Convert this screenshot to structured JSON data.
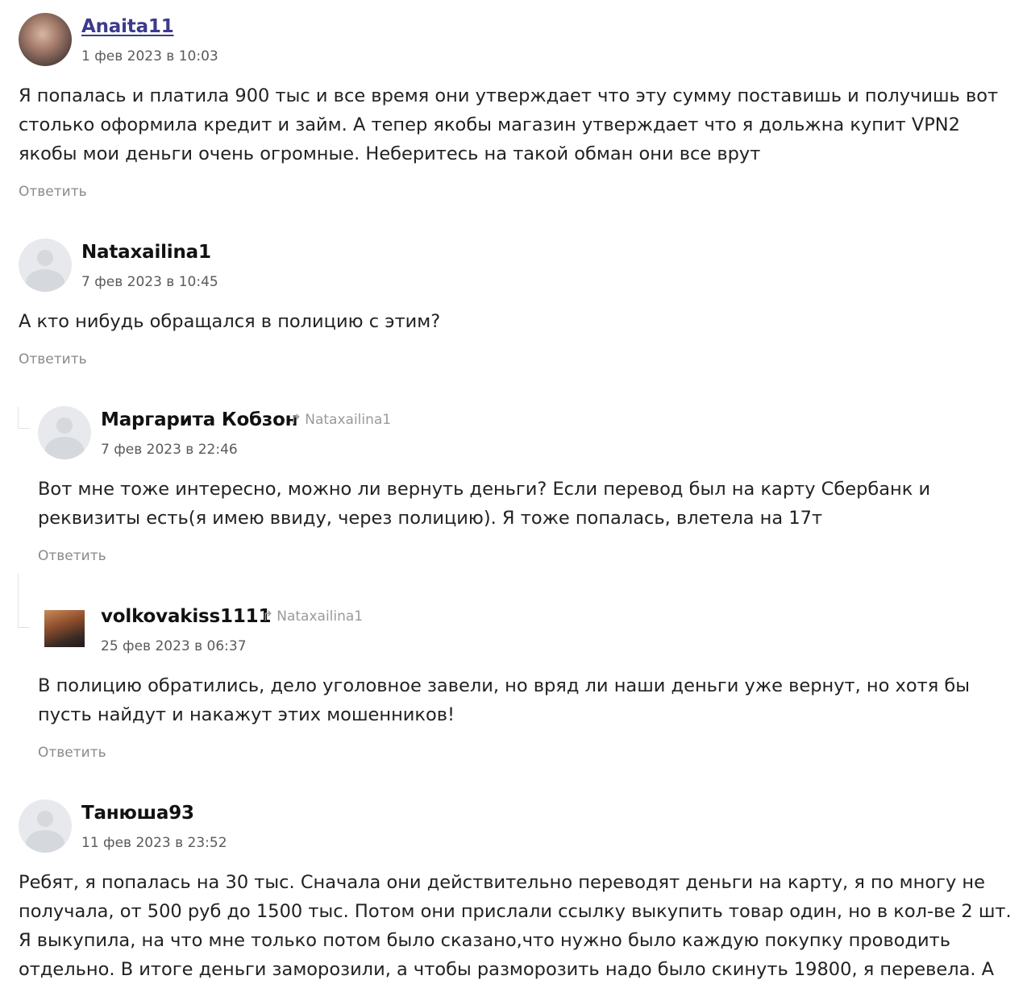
{
  "comments": [
    {
      "author": "Anaita11",
      "date": "1 фев 2023 в 10:03",
      "lines": [
        "Я попалась и платила 900 тыс и все время они утверждает что эту сумму поставишь и получишь вот",
        "столько оформила кредит и займ. А тепер якобы магазин утверждает что я дольжна купит VPN2",
        "якобы мои деньги очень огромные. Неберитесь на такой обман они все врут"
      ],
      "reply": "Ответить"
    },
    {
      "author": "Nataxailina1",
      "date": "7 фев 2023 в 10:45",
      "lines": [
        "А кто нибудь обращался в полицию с этим?"
      ],
      "reply": "Ответить"
    },
    {
      "author": "Маргарита Кобзон",
      "reply_to": "Nataxailina1",
      "date": "7 фев 2023 в 22:46",
      "lines": [
        "Вот мне тоже интересно, можно ли вернуть деньги? Если перевод был на карту Сбербанк и",
        "реквизиты есть(я имею ввиду, через полицию). Я тоже попалась, влетела на 17т"
      ],
      "reply": "Ответить"
    },
    {
      "author": "volkovakiss1111",
      "reply_to": "Nataxailina1",
      "date": "25 фев 2023 в 06:37",
      "lines": [
        "В полицию обратились, дело уголовное завели, но вряд ли наши деньги уже вернут, но хотя бы",
        "пусть найдут и накажут этих мошенников!"
      ],
      "reply": "Ответить"
    },
    {
      "author": "Танюша93",
      "date": "11 фев 2023 в 23:52",
      "lines": [
        "Ребят, я попалась на 30 тыс. Сначала они действительно переводят деньги на карту, я по многу не",
        "получала, от 500 руб до 1500 тыс. Потом они прислали ссылку выкупить товар один, но в кол-ве 2 шт.",
        "Я выкупила, на что мне только потом было сказано,что нужно было каждую покупку проводить",
        "отдельно. В итоге деньги заморозили, а чтобы разморозить надо было скинуть 19800, я перевела. А"
      ]
    }
  ],
  "icons": {
    "reply_arrow": "reply-arrow-icon",
    "avatar": "user-placeholder-icon"
  }
}
